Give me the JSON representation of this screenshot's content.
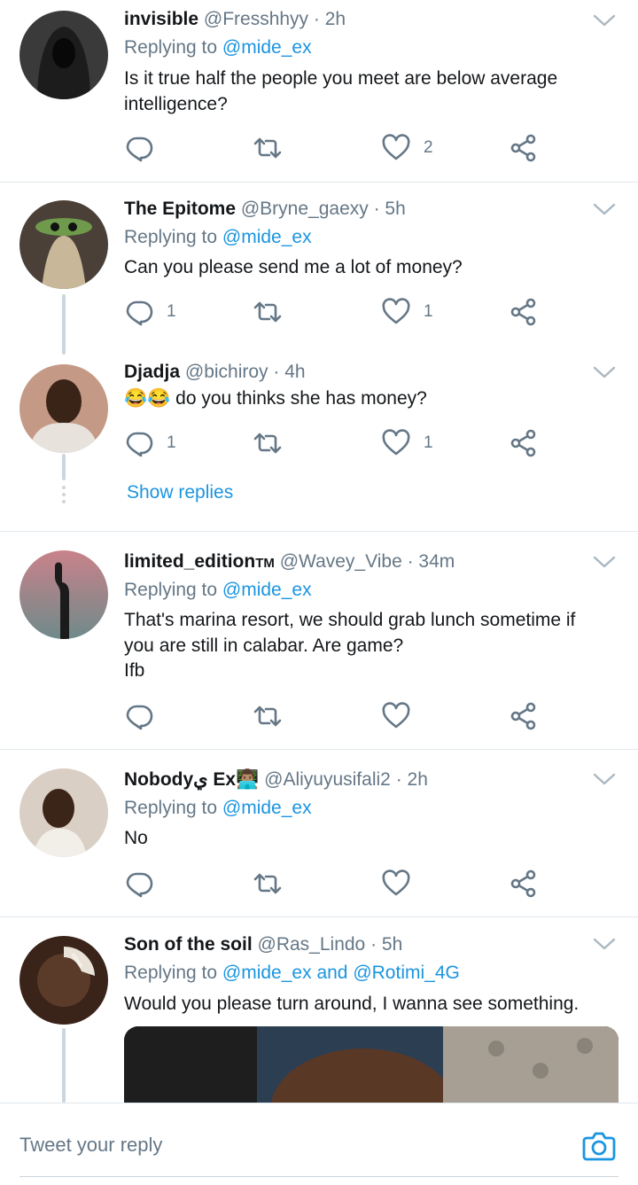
{
  "colors": {
    "accent": "#1b95e0",
    "muted": "#657786",
    "text": "#14171a",
    "divider": "#e1e8ed",
    "thread": "#ccd6dd"
  },
  "tweets": [
    {
      "name": "invisible",
      "handle": "@Fresshhyy",
      "time": "· 2h",
      "replying_prefix": "Replying to ",
      "replying_to": "@mide_ex",
      "text_lines": [
        "Is it true half the people you meet are below average",
        "intelligence?"
      ],
      "reply_count": "",
      "like_count": "2"
    },
    {
      "name": "The Epitome",
      "handle": "@Bryne_gaexy",
      "time": "· 5h",
      "replying_prefix": "Replying to ",
      "replying_to": "@mide_ex",
      "text_lines": [
        "Can you please send me a lot of money?"
      ],
      "reply_count": "1",
      "like_count": "1"
    },
    {
      "name": "Djadja",
      "handle": "@bichiroy",
      "time": "· 4h",
      "text_emoji": "😂😂",
      "text_lines": [
        "do you thinks she has money?"
      ],
      "reply_count": "1",
      "like_count": "1",
      "show_replies": "Show replies"
    },
    {
      "name": "limited_edition",
      "name_suffix": "TM",
      "handle": "@Wavey_Vibe",
      "time": "· 34m",
      "replying_prefix": "Replying to ",
      "replying_to": "@mide_ex",
      "text_lines": [
        "That's marina resort, we should grab lunch sometime if",
        "you are still in calabar. Are game?",
        "Ifb"
      ],
      "reply_count": "",
      "like_count": ""
    },
    {
      "name": "Nobodyي Ex",
      "name_emoji": "👨🏽‍💻",
      "handle": "@Aliyuyusifali2",
      "time": "· 2h",
      "replying_prefix": "Replying to ",
      "replying_to": "@mide_ex",
      "text_lines": [
        "No"
      ],
      "reply_count": "",
      "like_count": ""
    },
    {
      "name": "Son of the soil",
      "handle": "@Ras_Lindo",
      "time": "· 5h",
      "replying_prefix": "Replying to ",
      "replying_to": "@mide_ex",
      "replying_and": " and ",
      "replying_to_2": "@Rotimi_4G",
      "text_lines": [
        "Would you please turn around, I wanna see something."
      ]
    }
  ],
  "compose": {
    "placeholder": "Tweet your reply"
  },
  "icons": {
    "reply": "reply-icon",
    "retweet": "retweet-icon",
    "like": "heart-icon",
    "share": "share-icon",
    "caret": "chevron-down-icon",
    "camera": "camera-icon"
  }
}
